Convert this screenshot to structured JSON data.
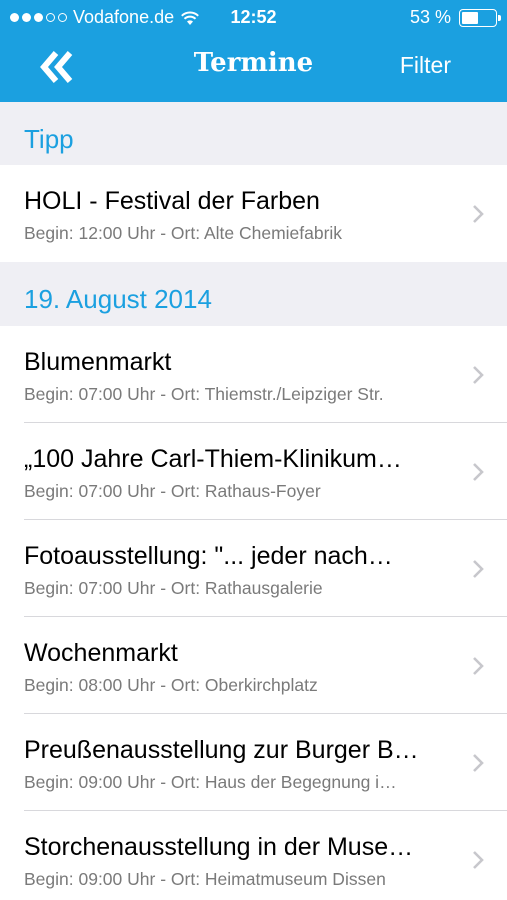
{
  "status": {
    "carrier": "Vodafone.de",
    "time": "12:52",
    "battery": "53 %",
    "battery_level": 0.53,
    "signal_dots": [
      true,
      true,
      true,
      false,
      false
    ]
  },
  "nav": {
    "back_icon": "double-chevron-left-icon",
    "title": "Termine",
    "filter_label": "Filter"
  },
  "sections": [
    {
      "header": "Tipp",
      "items": [
        {
          "title": "HOLI - Festival der Farben",
          "subtitle": "Begin: 12:00 Uhr - Ort: Alte Chemiefabrik"
        }
      ]
    },
    {
      "header": "19. August 2014",
      "items": [
        {
          "title": "Blumenmarkt",
          "subtitle": "Begin: 07:00 Uhr - Ort: Thiemstr./Leipziger Str."
        },
        {
          "title": "„100 Jahre Carl-Thiem-Klinikum…",
          "subtitle": "Begin: 07:00 Uhr - Ort: Rathaus-Foyer"
        },
        {
          "title": "Fotoausstellung:  \"... jeder nach…",
          "subtitle": "Begin: 07:00 Uhr - Ort: Rathausgalerie"
        },
        {
          "title": "Wochenmarkt",
          "subtitle": "Begin: 08:00 Uhr - Ort: Oberkirchplatz"
        },
        {
          "title": "Preußenausstellung zur Burger B…",
          "subtitle": "Begin: 09:00 Uhr - Ort: Haus der Begegnung i…"
        },
        {
          "title": "Storchenausstellung in der Muse…",
          "subtitle": "Begin: 09:00 Uhr - Ort: Heimatmuseum Dissen"
        }
      ]
    }
  ],
  "colors": {
    "accent": "#1ba0e0",
    "background": "#efeff4"
  }
}
